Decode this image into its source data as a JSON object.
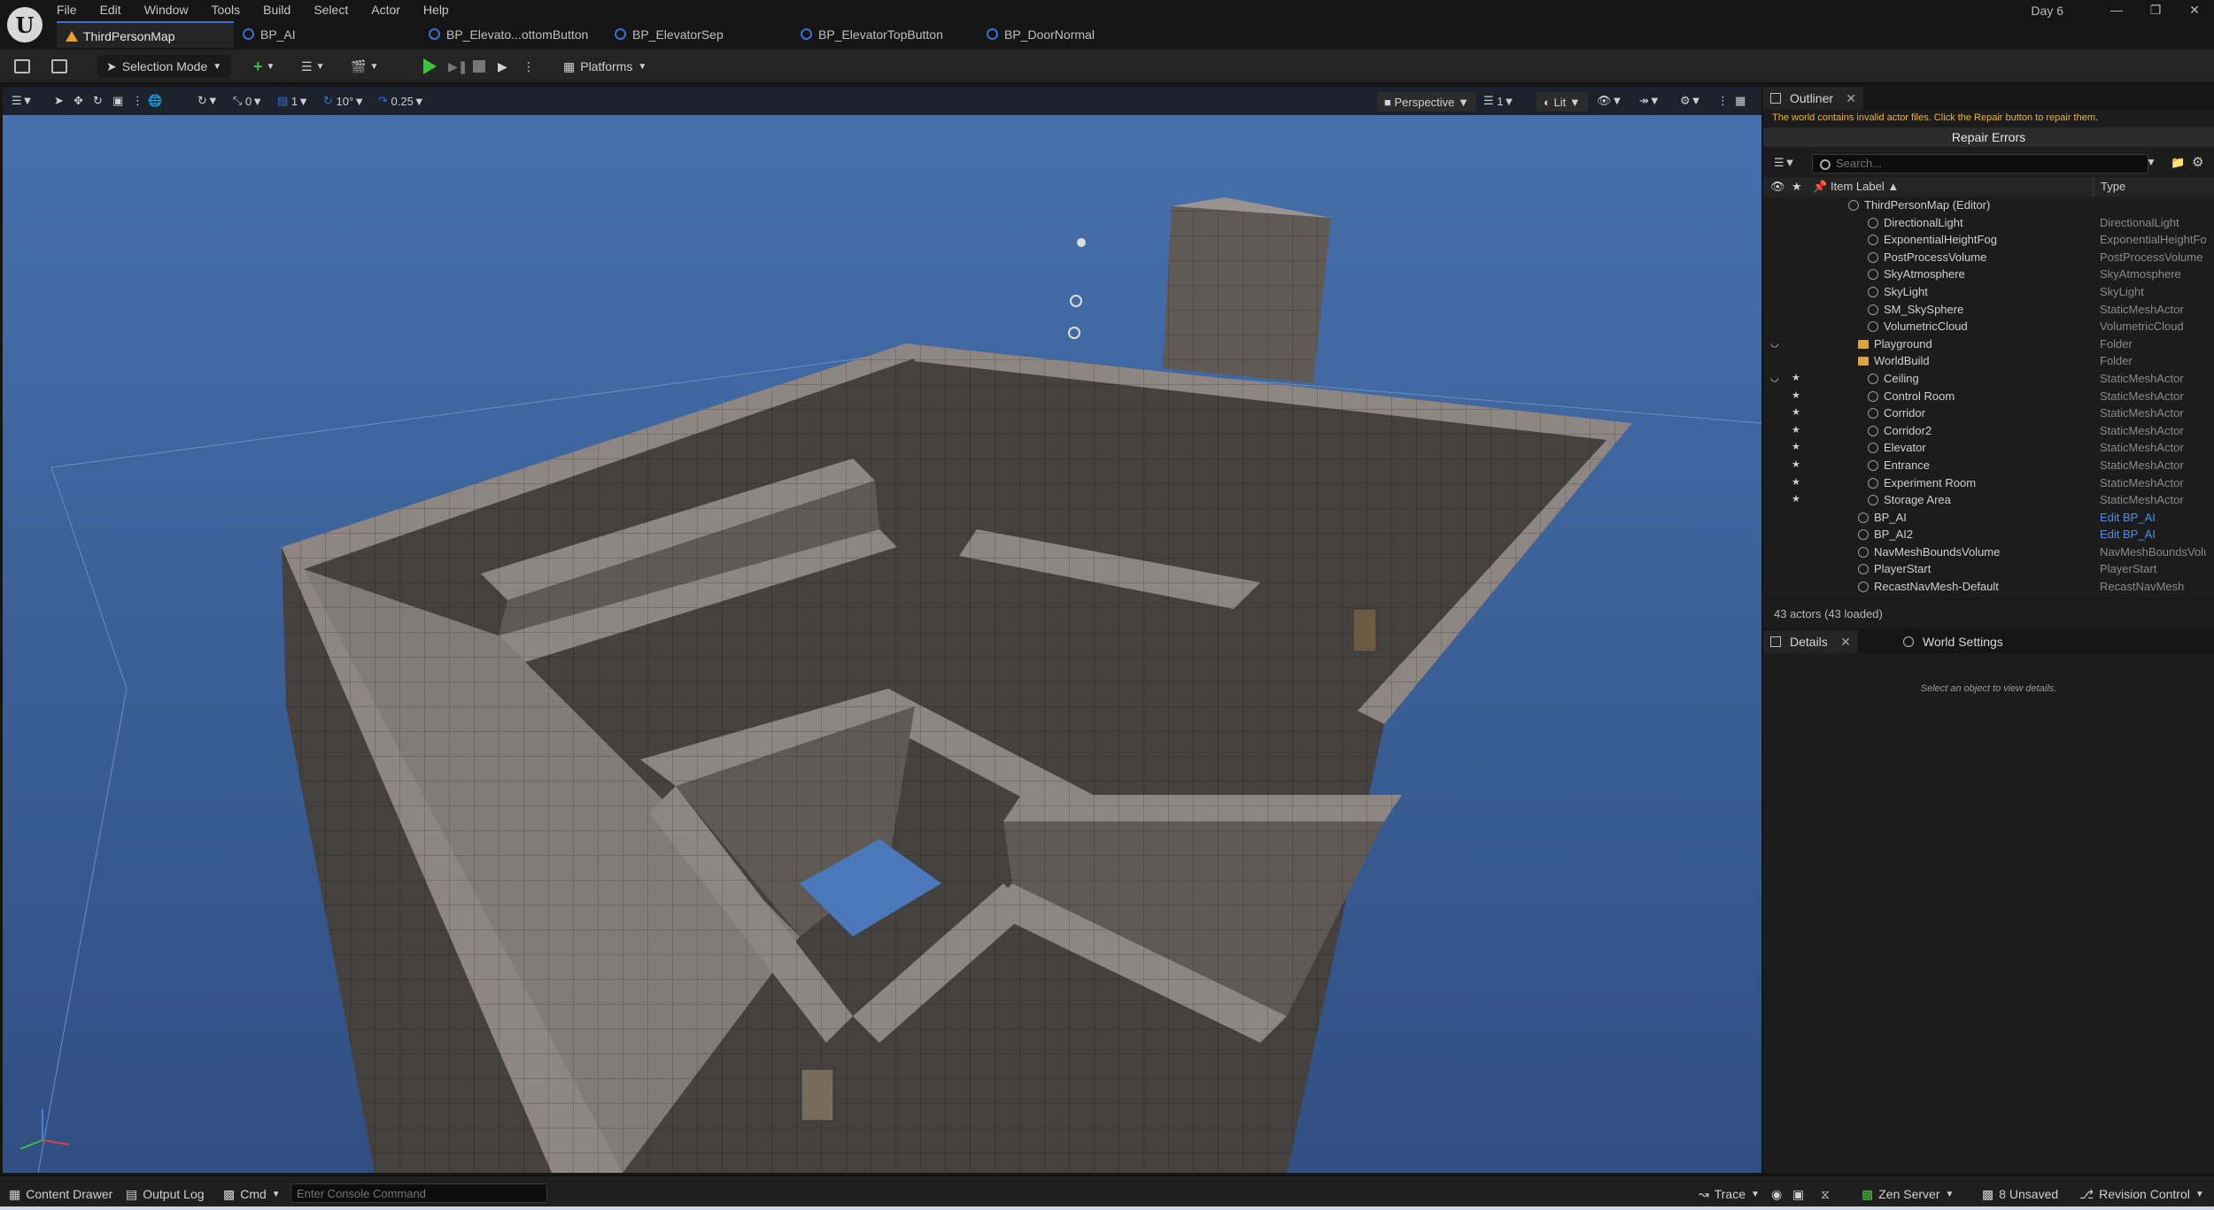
{
  "menu": [
    "File",
    "Edit",
    "Window",
    "Tools",
    "Build",
    "Select",
    "Actor",
    "Help"
  ],
  "project_title": "Day 6",
  "tabs": [
    {
      "label": "ThirdPersonMap",
      "active": true
    },
    {
      "label": "BP_AI",
      "active": false
    },
    {
      "label": "BP_Elevato...ottomButton",
      "active": false
    },
    {
      "label": "BP_ElevatorSep",
      "active": false
    },
    {
      "label": "BP_ElevatorTopButton",
      "active": false
    },
    {
      "label": "BP_DoorNormal",
      "active": false
    }
  ],
  "toolbar": {
    "selection_mode": "Selection Mode",
    "platforms": "Platforms"
  },
  "viewport_toolbar": {
    "rotate_snap": "0",
    "scale_snap": "1",
    "surface_snap": "1",
    "angle_snap": "10°",
    "grid_snap": "0.25",
    "view_mode": "Perspective",
    "layer": "1",
    "lighting": "Lit"
  },
  "outliner": {
    "tab_label": "Outliner",
    "warning": "The world contains invalid actor files. Click the Repair button to repair them.",
    "repair_button": "Repair Errors",
    "search_placeholder": "Search...",
    "col_label": "Item Label",
    "col_type": "Type",
    "rows": [
      {
        "label": "ThirdPersonMap (Editor)",
        "type": "",
        "indent": 0,
        "icon": "map",
        "star": false
      },
      {
        "label": "DirectionalLight",
        "type": "DirectionalLight",
        "indent": 2,
        "icon": "light",
        "star": false
      },
      {
        "label": "ExponentialHeightFog",
        "type": "ExponentialHeightFog",
        "indent": 2,
        "icon": "fog",
        "star": false
      },
      {
        "label": "PostProcessVolume",
        "type": "PostProcessVolume",
        "indent": 2,
        "icon": "volume",
        "star": false
      },
      {
        "label": "SkyAtmosphere",
        "type": "SkyAtmosphere",
        "indent": 2,
        "icon": "sky",
        "star": false
      },
      {
        "label": "SkyLight",
        "type": "SkyLight",
        "indent": 2,
        "icon": "light",
        "star": false
      },
      {
        "label": "SM_SkySphere",
        "type": "StaticMeshActor",
        "indent": 2,
        "icon": "mesh",
        "star": false
      },
      {
        "label": "VolumetricCloud",
        "type": "VolumetricCloud",
        "indent": 2,
        "icon": "cloud",
        "star": false
      },
      {
        "label": "Playground",
        "type": "Folder",
        "indent": 1,
        "icon": "folder",
        "star": false,
        "eye": true
      },
      {
        "label": "WorldBuild",
        "type": "Folder",
        "indent": 1,
        "icon": "folder",
        "star": false
      },
      {
        "label": "Ceiling",
        "type": "StaticMeshActor",
        "indent": 2,
        "icon": "mesh",
        "star": true,
        "eye": true
      },
      {
        "label": "Control Room",
        "type": "StaticMeshActor",
        "indent": 2,
        "icon": "mesh",
        "star": true
      },
      {
        "label": "Corridor",
        "type": "StaticMeshActor",
        "indent": 2,
        "icon": "mesh",
        "star": true
      },
      {
        "label": "Corridor2",
        "type": "StaticMeshActor",
        "indent": 2,
        "icon": "mesh",
        "star": true
      },
      {
        "label": "Elevator",
        "type": "StaticMeshActor",
        "indent": 2,
        "icon": "mesh",
        "star": true
      },
      {
        "label": "Entrance",
        "type": "StaticMeshActor",
        "indent": 2,
        "icon": "mesh",
        "star": true
      },
      {
        "label": "Experiment Room",
        "type": "StaticMeshActor",
        "indent": 2,
        "icon": "mesh",
        "star": true
      },
      {
        "label": "Storage Area",
        "type": "StaticMeshActor",
        "indent": 2,
        "icon": "mesh",
        "star": true
      },
      {
        "label": "BP_AI",
        "type": "Edit BP_AI",
        "indent": 1,
        "icon": "pawn",
        "star": false,
        "link": true
      },
      {
        "label": "BP_AI2",
        "type": "Edit BP_AI",
        "indent": 1,
        "icon": "pawn",
        "star": false,
        "link": true
      },
      {
        "label": "NavMeshBoundsVolume",
        "type": "NavMeshBoundsVolume",
        "indent": 1,
        "icon": "volume",
        "star": false
      },
      {
        "label": "PlayerStart",
        "type": "PlayerStart",
        "indent": 1,
        "icon": "player",
        "star": false
      },
      {
        "label": "RecastNavMesh-Default",
        "type": "RecastNavMesh",
        "indent": 1,
        "icon": "nav",
        "star": false
      }
    ],
    "actor_count": "43 actors (43 loaded)"
  },
  "details": {
    "tab_label": "Details",
    "world_settings_tab": "World Settings",
    "empty_message": "Select an object to view details."
  },
  "statusbar": {
    "content_drawer": "Content Drawer",
    "output_log": "Output Log",
    "cmd": "Cmd",
    "console_placeholder": "Enter Console Command",
    "trace": "Trace",
    "zen_server": "Zen Server",
    "unsaved": "8 Unsaved",
    "revision_control": "Revision Control"
  },
  "colors": {
    "accent": "#3b6fd6",
    "warning": "#f0b428",
    "link": "#4d8ef0",
    "play": "#3fc13f"
  }
}
